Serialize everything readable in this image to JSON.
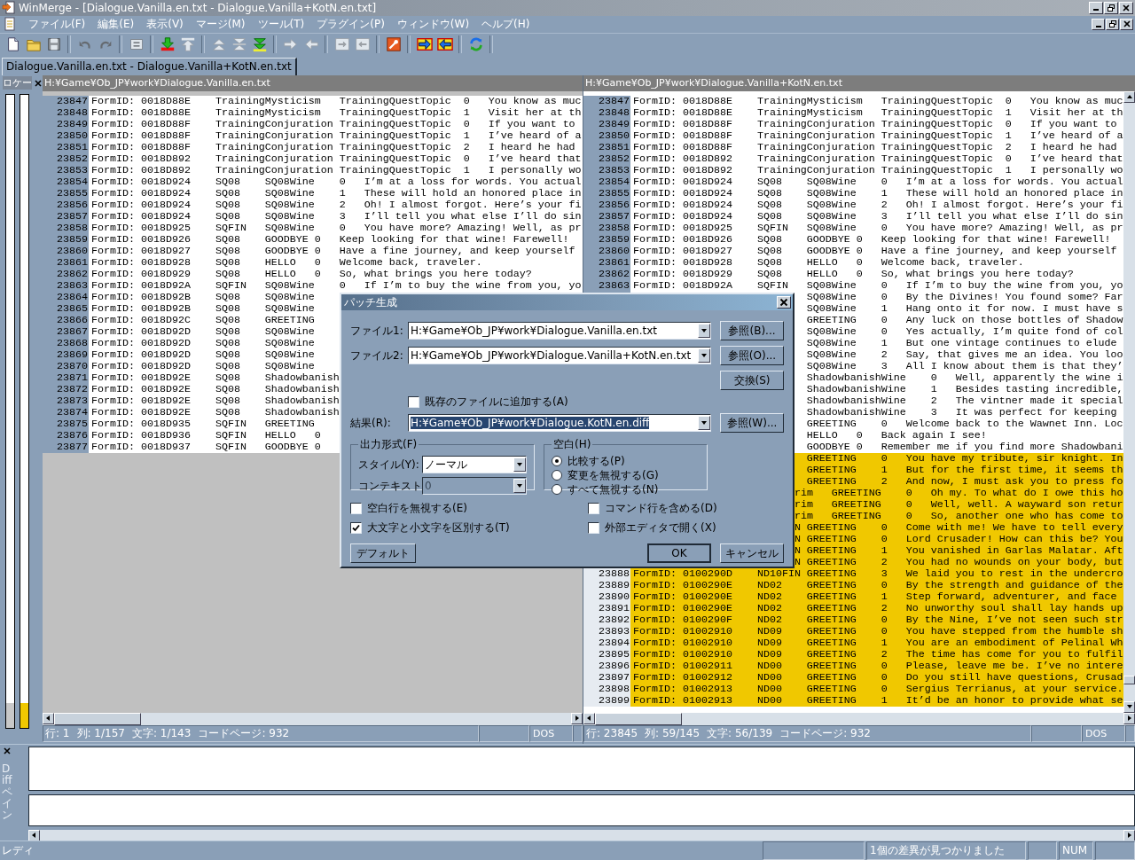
{
  "window": {
    "title": "WinMerge - [Dialogue.Vanilla.en.txt - Dialogue.Vanilla+KotN.en.txt]"
  },
  "menu": [
    "ファイル(F)",
    "編集(E)",
    "表示(V)",
    "マージ(M)",
    "ツール(T)",
    "プラグイン(P)",
    "ウィンドウ(W)",
    "ヘルプ(H)"
  ],
  "toolbar": [
    [
      {
        "disabled": false
      },
      {
        "disabled": false
      },
      {
        "disabled": true
      }
    ],
    [
      {
        "disabled": true
      },
      {
        "disabled": true
      }
    ],
    [
      {
        "disabled": true
      }
    ],
    [
      {
        "disabled": false
      },
      {
        "disabled": true
      }
    ],
    [
      {
        "disabled": true
      },
      {
        "disabled": true
      },
      {
        "disabled": false
      }
    ],
    [
      {
        "disabled": true
      },
      {
        "disabled": true
      }
    ],
    [
      {
        "disabled": true
      },
      {
        "disabled": true
      }
    ],
    [
      {
        "disabled": false
      }
    ],
    [
      {
        "disabled": false
      },
      {
        "disabled": false
      }
    ],
    [
      {
        "disabled": false
      }
    ]
  ],
  "tabs": [
    {
      "label": "Dialogue.Vanilla.en.txt - Dialogue.Vanilla+KotN.en.txt",
      "selected": true
    }
  ],
  "location_pane": {
    "title": "ロケー"
  },
  "panes": [
    {
      "path": "H:¥Game¥Ob_JP¥work¥Dialogue.Vanilla.en.txt",
      "rows": [
        {
          "number": "23847",
          "text": "FormID: 0018D88E\tTrainingMysticism\tTrainingQuestTopic\t0\tYou know as muc",
          "diff": false
        },
        {
          "number": "23848",
          "text": "FormID: 0018D88E\tTrainingMysticism\tTrainingQuestTopic\t1\tVisit her at th",
          "diff": false
        },
        {
          "number": "23849",
          "text": "FormID: 0018D88F\tTrainingConjuration\tTrainingQuestTopic\t0\tIf you want to",
          "diff": false
        },
        {
          "number": "23850",
          "text": "FormID: 0018D88F\tTrainingConjuration\tTrainingQuestTopic\t1\tI’ve heard of a",
          "diff": false
        },
        {
          "number": "23851",
          "text": "FormID: 0018D88F\tTrainingConjuration\tTrainingQuestTopic\t2\tI heard he had",
          "diff": false
        },
        {
          "number": "23852",
          "text": "FormID: 0018D892\tTrainingConjuration\tTrainingQuestTopic\t0\tI’ve heard that",
          "diff": false
        },
        {
          "number": "23853",
          "text": "FormID: 0018D892\tTrainingConjuration\tTrainingQuestTopic\t1\tI personally wo",
          "diff": false
        },
        {
          "number": "23854",
          "text": "FormID: 0018D924\tSQ08\tSQ08Wine\t0\tI’m at a loss for words. You actual",
          "diff": false
        },
        {
          "number": "23855",
          "text": "FormID: 0018D924\tSQ08\tSQ08Wine\t1\tThese will hold an honored place in",
          "diff": false
        },
        {
          "number": "23856",
          "text": "FormID: 0018D924\tSQ08\tSQ08Wine\t2\tOh! I almost forgot. Here’s your fi",
          "diff": false
        },
        {
          "number": "23857",
          "text": "FormID: 0018D924\tSQ08\tSQ08Wine\t3\tI’ll tell you what else I’ll do sin",
          "diff": false
        },
        {
          "number": "23858",
          "text": "FormID: 0018D925\tSQFIN\tSQ08Wine\t0\tYou have more? Amazing! Well, as pr",
          "diff": false
        },
        {
          "number": "23859",
          "text": "FormID: 0018D926\tSQ08\tGOODBYE\t0\tKeep looking for that wine! Farewell!",
          "diff": false
        },
        {
          "number": "23860",
          "text": "FormID: 0018D927\tSQ08\tGOODBYE\t0\tHave a fine journey, and keep yourself",
          "diff": false
        },
        {
          "number": "23861",
          "text": "FormID: 0018D928\tSQ08\tHELLO\t0\tWelcome back, traveler.",
          "diff": false
        },
        {
          "number": "23862",
          "text": "FormID: 0018D929\tSQ08\tHELLO\t0\tSo, what brings you here today?",
          "diff": false
        },
        {
          "number": "23863",
          "text": "FormID: 0018D92A\tSQFIN\tSQ08Wine\t0\tIf I’m to buy the wine from you, yo",
          "diff": false
        },
        {
          "number": "23864",
          "text": "FormID: 0018D92B\tSQ08\tSQ08Wine",
          "diff": false
        },
        {
          "number": "23865",
          "text": "FormID: 0018D92B\tSQ08\tSQ08Wine",
          "diff": false
        },
        {
          "number": "23866",
          "text": "FormID: 0018D92C\tSQ08\tGREETING",
          "diff": false
        },
        {
          "number": "23867",
          "text": "FormID: 0018D92D\tSQ08\tSQ08Wine",
          "diff": false
        },
        {
          "number": "23868",
          "text": "FormID: 0018D92D\tSQ08\tSQ08Wine",
          "diff": false
        },
        {
          "number": "23869",
          "text": "FormID: 0018D92D\tSQ08\tSQ08Wine",
          "diff": false
        },
        {
          "number": "23870",
          "text": "FormID: 0018D92D\tSQ08\tSQ08Wine",
          "diff": false
        },
        {
          "number": "23871",
          "text": "FormID: 0018D92E\tSQ08\tShadowbanish",
          "diff": false
        },
        {
          "number": "23872",
          "text": "FormID: 0018D92E\tSQ08\tShadowbanish",
          "diff": false
        },
        {
          "number": "23873",
          "text": "FormID: 0018D92E\tSQ08\tShadowbanish",
          "diff": false
        },
        {
          "number": "23874",
          "text": "FormID: 0018D92E\tSQ08\tShadowbanish",
          "diff": false
        },
        {
          "number": "23875",
          "text": "FormID: 0018D935\tSQFIN\tGREETING",
          "diff": false
        },
        {
          "number": "23876",
          "text": "FormID: 0018D936\tSQFIN\tHELLO\t0",
          "diff": false
        },
        {
          "number": "23877",
          "text": "FormID: 0018D937\tSQFIN\tGOODBYE\t0",
          "diff": false
        }
      ],
      "status": [
        "行: 1",
        "列: 1/157",
        "文字: 1/143",
        "コードページ: 932"
      ],
      "eol": "DOS"
    },
    {
      "path": "H:¥Game¥Ob_JP¥work¥Dialogue.Vanilla+KotN.en.txt",
      "rows": [
        {
          "number": "23847",
          "text": "FormID: 0018D88E\tTrainingMysticism\tTrainingQuestTopic\t0\tYou know as muc",
          "diff": false
        },
        {
          "number": "23848",
          "text": "FormID: 0018D88E\tTrainingMysticism\tTrainingQuestTopic\t1\tVisit her at th",
          "diff": false
        },
        {
          "number": "23849",
          "text": "FormID: 0018D88F\tTrainingConjuration\tTrainingQuestTopic\t0\tIf you want to",
          "diff": false
        },
        {
          "number": "23850",
          "text": "FormID: 0018D88F\tTrainingConjuration\tTrainingQuestTopic\t1\tI’ve heard of a",
          "diff": false
        },
        {
          "number": "23851",
          "text": "FormID: 0018D88F\tTrainingConjuration\tTrainingQuestTopic\t2\tI heard he had",
          "diff": false
        },
        {
          "number": "23852",
          "text": "FormID: 0018D892\tTrainingConjuration\tTrainingQuestTopic\t0\tI’ve heard that",
          "diff": false
        },
        {
          "number": "23853",
          "text": "FormID: 0018D892\tTrainingConjuration\tTrainingQuestTopic\t1\tI personally wo",
          "diff": false
        },
        {
          "number": "23854",
          "text": "FormID: 0018D924\tSQ08\tSQ08Wine\t0\tI’m at a loss for words. You actual",
          "diff": false
        },
        {
          "number": "23855",
          "text": "FormID: 0018D924\tSQ08\tSQ08Wine\t1\tThese will hold an honored place in",
          "diff": false
        },
        {
          "number": "23856",
          "text": "FormID: 0018D924\tSQ08\tSQ08Wine\t2\tOh! I almost forgot. Here’s your fi",
          "diff": false
        },
        {
          "number": "23857",
          "text": "FormID: 0018D924\tSQ08\tSQ08Wine\t3\tI’ll tell you what else I’ll do sin",
          "diff": false
        },
        {
          "number": "23858",
          "text": "FormID: 0018D925\tSQFIN\tSQ08Wine\t0\tYou have more? Amazing! Well, as pr",
          "diff": false
        },
        {
          "number": "23859",
          "text": "FormID: 0018D926\tSQ08\tGOODBYE\t0\tKeep looking for that wine! Farewell!",
          "diff": false
        },
        {
          "number": "23860",
          "text": "FormID: 0018D927\tSQ08\tGOODBYE\t0\tHave a fine journey, and keep yourself",
          "diff": false
        },
        {
          "number": "23861",
          "text": "FormID: 0018D928\tSQ08\tHELLO\t0\tWelcome back, traveler.",
          "diff": false
        },
        {
          "number": "23862",
          "text": "FormID: 0018D929\tSQ08\tHELLO\t0\tSo, what brings you here today?",
          "diff": false
        },
        {
          "number": "23863",
          "text": "FormID: 0018D92A\tSQFIN\tSQ08Wine\t0\tIf I’m to buy the wine from you, yo",
          "diff": false
        },
        {
          "text": "\tSQ08Wine\t0\tBy the Divines! You found some? Far",
          "diff": false
        },
        {
          "text": "\tSQ08Wine\t1\tHang onto it for now. I must have s",
          "diff": false
        },
        {
          "text": "\tGREETING\t0\tAny luck on those bottles of Shadow",
          "diff": false
        },
        {
          "text": "\tSQ08Wine\t0\tYes actually, I’m quite fond of col",
          "diff": false
        },
        {
          "text": "\tSQ08Wine\t1\tBut one vintage continues to elude",
          "diff": false
        },
        {
          "text": "\tSQ08Wine\t2\tSay, that gives me an idea. You loo",
          "diff": false
        },
        {
          "text": "\tSQ08Wine\t3\tAll I know about them is that they’",
          "diff": false
        },
        {
          "text": "\tShadowbanishWine\t0\tWell, apparently the wine i",
          "diff": false
        },
        {
          "text": "\tShadowbanishWine\t1\tBesides tasting incredible,",
          "diff": false
        },
        {
          "text": "\tShadowbanishWine\t2\tThe vintner made it special",
          "diff": false
        },
        {
          "text": "\tShadowbanishWine\t3\tIt was perfect for keeping",
          "diff": false
        },
        {
          "text": "\tGREETING\t0\tWelcome back to the Wawnet Inn. Loc",
          "diff": false
        },
        {
          "text": "\tHELLO\t0\tBack again I see!",
          "diff": false
        },
        {
          "text": "\tGOODBYE\t0\tRemember me if you find more Shadowbani",
          "diff": false
        },
        {
          "text": "\tGREETING\t0\tYou have my tribute, sir knight. In",
          "diff": true
        },
        {
          "text": "\tGREETING\t1\tBut for the first time, it seems th",
          "diff": true
        },
        {
          "text": "\tGREETING\t2\tAnd now, I must ask you to press fo",
          "diff": true
        },
        {
          "text": "rim\tGREETING\t0\tOh my. To what do I owe this ho",
          "diff": true
        },
        {
          "text": "rim\tGREETING\t0\tWell, well. A wayward son retur",
          "diff": true
        },
        {
          "text": "rim\tGREETING\t0\tSo, another one who has come to",
          "diff": true
        },
        {
          "text": "N\tGREETING\t0\tCome with me! We have to tell every",
          "diff": true
        },
        {
          "text": "N\tGREETING\t0\tLord Crusader! How can this be? You",
          "diff": true
        },
        {
          "text": "N\tGREETING\t1\tYou vanished in Garlas Malatar. Aft",
          "diff": true
        },
        {
          "text": "N\tGREETING\t2\tYou had no wounds on your body, but",
          "diff": true
        },
        {
          "number": "23888",
          "text": "FormID: 0100290D\tND10FIN\tGREETING\t3\tWe laid you to rest in the undercro",
          "diff": true
        },
        {
          "number": "23889",
          "text": "FormID: 0100290E\tND02\tGREETING\t0\tBy the strength and guidance of the",
          "diff": true
        },
        {
          "number": "23890",
          "text": "FormID: 0100290E\tND02\tGREETING\t1\tStep forward, adventurer, and face",
          "diff": true
        },
        {
          "number": "23891",
          "text": "FormID: 0100290E\tND02\tGREETING\t2\tNo unworthy soul shall lay hands up",
          "diff": true
        },
        {
          "number": "23892",
          "text": "FormID: 0100290F\tND02\tGREETING\t0\tBy the Nine, I’ve not seen such str",
          "diff": true
        },
        {
          "number": "23893",
          "text": "FormID: 01002910\tND09\tGREETING\t0\tYou have stepped from the humble sh",
          "diff": true
        },
        {
          "number": "23894",
          "text": "FormID: 01002910\tND09\tGREETING\t1\tYou are an embodiment of Pelinal Wh",
          "diff": true
        },
        {
          "number": "23895",
          "text": "FormID: 01002910\tND09\tGREETING\t2\tThe time has come for you to fulfil",
          "diff": true
        },
        {
          "number": "23896",
          "text": "FormID: 01002911\tND00\tGREETING\t0\tPlease, leave me be. I’ve no intere",
          "diff": true
        },
        {
          "number": "23897",
          "text": "FormID: 01002912\tND00\tGREETING\t0\tDo you still have questions, Crusad",
          "diff": true
        },
        {
          "number": "23898",
          "text": "FormID: 01002913\tND00\tGREETING\t0\tSergius Terrianus, at your service.",
          "diff": true
        },
        {
          "number": "23899",
          "text": "FormID: 01002913\tND00\tGREETING\t1\tIt’d be an honor to provide what se",
          "diff": true
        }
      ],
      "status": [
        "行: 23845",
        "列: 59/145",
        "文字: 56/139",
        "コードページ: 932"
      ],
      "eol": "DOS"
    }
  ],
  "diff_pane": {
    "title": "Diffペイン"
  },
  "status_bar": {
    "message": "レディ",
    "diff_count": "1個の差異が見つかりました",
    "num": "NUM"
  },
  "dialog": {
    "title": "パッチ生成",
    "files": [
      {
        "label": "ファイル1:",
        "value": "H:¥Game¥Ob_JP¥work¥Dialogue.Vanilla.en.txt",
        "button": "参照(B)..."
      },
      {
        "label": "ファイル2:",
        "value": "H:¥Game¥Ob_JP¥work¥Dialogue.Vanilla+KotN.en.txt",
        "button": "参照(O)..."
      }
    ],
    "swap_button": "交換(S)",
    "append": {
      "label": "既存のファイルに追加する(A)",
      "checked": false
    },
    "result": {
      "label": "結果(R):",
      "value": "H:¥Game¥Ob_JP¥work¥Dialogue.KotN.en.diff",
      "selected": true,
      "button": "参照(W)..."
    },
    "output_format": {
      "title": "出力形式(F)",
      "style_label": "スタイル(Y):",
      "style_value": "ノーマル",
      "context_label": "コンテキスト",
      "context_value": "0",
      "context_disabled": true
    },
    "whitespace": {
      "title": "空白(H)",
      "options": [
        {
          "label": "比較する(P)",
          "selected": true
        },
        {
          "label": "変更を無視する(G)",
          "selected": false
        },
        {
          "label": "すべて無視する(N)",
          "selected": false
        }
      ]
    },
    "checkboxes": [
      {
        "label": "空白行を無視する(E)",
        "checked": false
      },
      {
        "label": "大文字と小文字を区別する(T)",
        "checked": true
      },
      {
        "label": "コマンド行を含める(D)",
        "checked": false
      },
      {
        "label": "外部エディタで開く(X)",
        "checked": false
      }
    ],
    "default_button": "デフォルト",
    "ok_button": "OK",
    "cancel_button": "キャンセル"
  }
}
